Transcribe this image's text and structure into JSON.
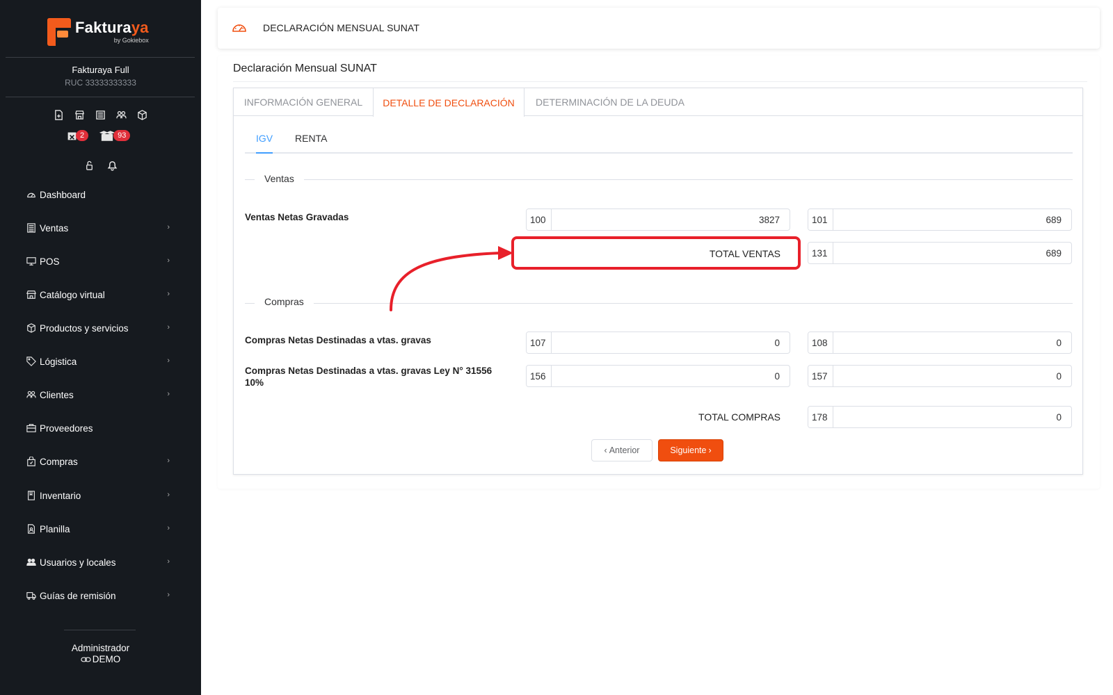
{
  "brand": {
    "name_a": "Faktura",
    "name_b": "ya",
    "by": "by Gokiebox",
    "accent": "#f35b1c"
  },
  "company": {
    "name": "Fakturaya Full",
    "ruc": "RUC 33333333333"
  },
  "sidebar_badges": {
    "calendar_count": "2",
    "boxes_count": "93"
  },
  "nav": [
    {
      "label": "Dashboard",
      "icon": "gauge-icon"
    },
    {
      "label": "Ventas",
      "icon": "receipt-icon"
    },
    {
      "label": "POS",
      "icon": "monitor-icon"
    },
    {
      "label": "Catálogo virtual",
      "icon": "store-icon"
    },
    {
      "label": "Productos y servicios",
      "icon": "box-icon"
    },
    {
      "label": "Lógistica",
      "icon": "tag-icon"
    },
    {
      "label": "Clientes",
      "icon": "users-icon"
    },
    {
      "label": "Proveedores",
      "icon": "briefcase-icon"
    },
    {
      "label": "Compras",
      "icon": "bag-icon"
    },
    {
      "label": "Inventario",
      "icon": "book-icon"
    },
    {
      "label": "Planilla",
      "icon": "id-file-icon"
    },
    {
      "label": "Usuarios y locales",
      "icon": "user-group-icon"
    },
    {
      "label": "Guías de remisión",
      "icon": "truck-icon"
    }
  ],
  "user": {
    "role": "Administrador",
    "mode": "DEMO"
  },
  "header": {
    "title": "DECLARACIÓN MENSUAL SUNAT"
  },
  "card": {
    "title": "Declaración Mensual SUNAT"
  },
  "tabs": [
    {
      "label": "INFORMACIÓN GENERAL"
    },
    {
      "label": "DETALLE DE DECLARACIÓN"
    },
    {
      "label": "DETERMINACIÓN DE LA DEUDA"
    }
  ],
  "subtabs": [
    {
      "label": "IGV"
    },
    {
      "label": "RENTA"
    }
  ],
  "ventas": {
    "section": "Ventas",
    "row_label": "Ventas Netas Gravadas",
    "f100": {
      "code": "100",
      "value": "3827"
    },
    "f101": {
      "code": "101",
      "value": "689"
    },
    "total_label": "TOTAL VENTAS",
    "f131": {
      "code": "131",
      "value": "689"
    }
  },
  "compras": {
    "section": "Compras",
    "row1_label": "Compras Netas Destinadas a vtas. gravas",
    "f107": {
      "code": "107",
      "value": "0"
    },
    "f108": {
      "code": "108",
      "value": "0"
    },
    "row2_label": "Compras Netas Destinadas a vtas. gravas Ley N° 31556 10%",
    "f156": {
      "code": "156",
      "value": "0"
    },
    "f157": {
      "code": "157",
      "value": "0"
    },
    "total_label": "TOTAL COMPRAS",
    "f178": {
      "code": "178",
      "value": "0"
    }
  },
  "buttons": {
    "prev": "Anterior",
    "next": "Siguiente"
  },
  "colors": {
    "accent": "#f04e0f",
    "link": "#409eff",
    "annotation": "#e8202a",
    "sidebar_bg": "#161a1f"
  }
}
